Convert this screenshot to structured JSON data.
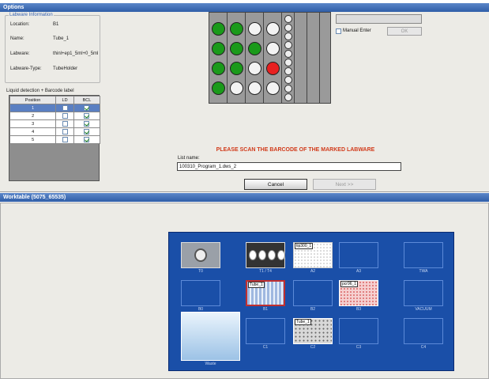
{
  "window": {
    "options_title": "Options",
    "worktable_title": "Worktable (5075_65535)"
  },
  "labware_info": {
    "legend": "Labware Information",
    "fields": [
      {
        "label": "Location:",
        "value": "B1"
      },
      {
        "label": "Name:",
        "value": "Tube_1"
      },
      {
        "label": "Labware:",
        "value": "thinl+ep1_5ml+0_5ml"
      },
      {
        "label": "Labware-Type:",
        "value": "TubeHolder"
      }
    ]
  },
  "detection_caption": "Liquid detection + Barcode label",
  "positions": {
    "headers": [
      "Position",
      "LD",
      "BCL"
    ],
    "rows": [
      {
        "pos": "1",
        "ld": false,
        "bcl": true,
        "selected": true
      },
      {
        "pos": "2",
        "ld": false,
        "bcl": true,
        "selected": false
      },
      {
        "pos": "3",
        "ld": false,
        "bcl": true,
        "selected": false
      },
      {
        "pos": "4",
        "ld": false,
        "bcl": true,
        "selected": false
      },
      {
        "pos": "5",
        "ld": false,
        "bcl": true,
        "selected": false
      }
    ]
  },
  "rack": {
    "columns": [
      [
        "green",
        "green",
        "green",
        "green"
      ],
      [
        "green",
        "green",
        "green",
        "empty"
      ],
      [
        "empty",
        "green",
        "empty",
        "empty"
      ],
      [
        "empty",
        "empty",
        "red",
        "empty"
      ]
    ]
  },
  "manual_enter": {
    "label": "Manual Enter",
    "checked": false
  },
  "ok_label": "OK",
  "scan_message": "PLEASE SCAN THE BARCODE OF THE MARKED LABWARE",
  "list_name": {
    "label": "List name:",
    "value": "100310_Program_1.dws_2"
  },
  "cancel_label": "Cancel",
  "next_label": "Next >>",
  "deck": {
    "slots": [
      {
        "id": "T0",
        "label": "T0",
        "content": "holder"
      },
      {
        "id": "T1T4",
        "label": "T1 / T4",
        "content": "tubes"
      },
      {
        "id": "A2",
        "label": "A2",
        "content": "plate",
        "name": "tip300_1"
      },
      {
        "id": "A3",
        "label": "A3",
        "content": "empty"
      },
      {
        "id": "TWA",
        "label": "TWA",
        "content": "empty"
      },
      {
        "id": "B0",
        "label": "B0",
        "content": "empty"
      },
      {
        "id": "B1",
        "label": "B1",
        "content": "tuberack",
        "name": "Tube_1"
      },
      {
        "id": "B2",
        "label": "B2",
        "content": "empty"
      },
      {
        "id": "B3",
        "label": "B3",
        "content": "pcrplate",
        "name": "pcr96_1"
      },
      {
        "id": "VACUUM",
        "label": "VACUUM",
        "content": "empty"
      },
      {
        "id": "Waste",
        "label": "Waste",
        "content": "waste"
      },
      {
        "id": "C1",
        "label": "C1",
        "content": "empty"
      },
      {
        "id": "C2",
        "label": "C2",
        "content": "tubeplate",
        "name": "Tube_1"
      },
      {
        "id": "C3",
        "label": "C3",
        "content": "empty"
      },
      {
        "id": "C4",
        "label": "C4",
        "content": "empty"
      }
    ]
  }
}
